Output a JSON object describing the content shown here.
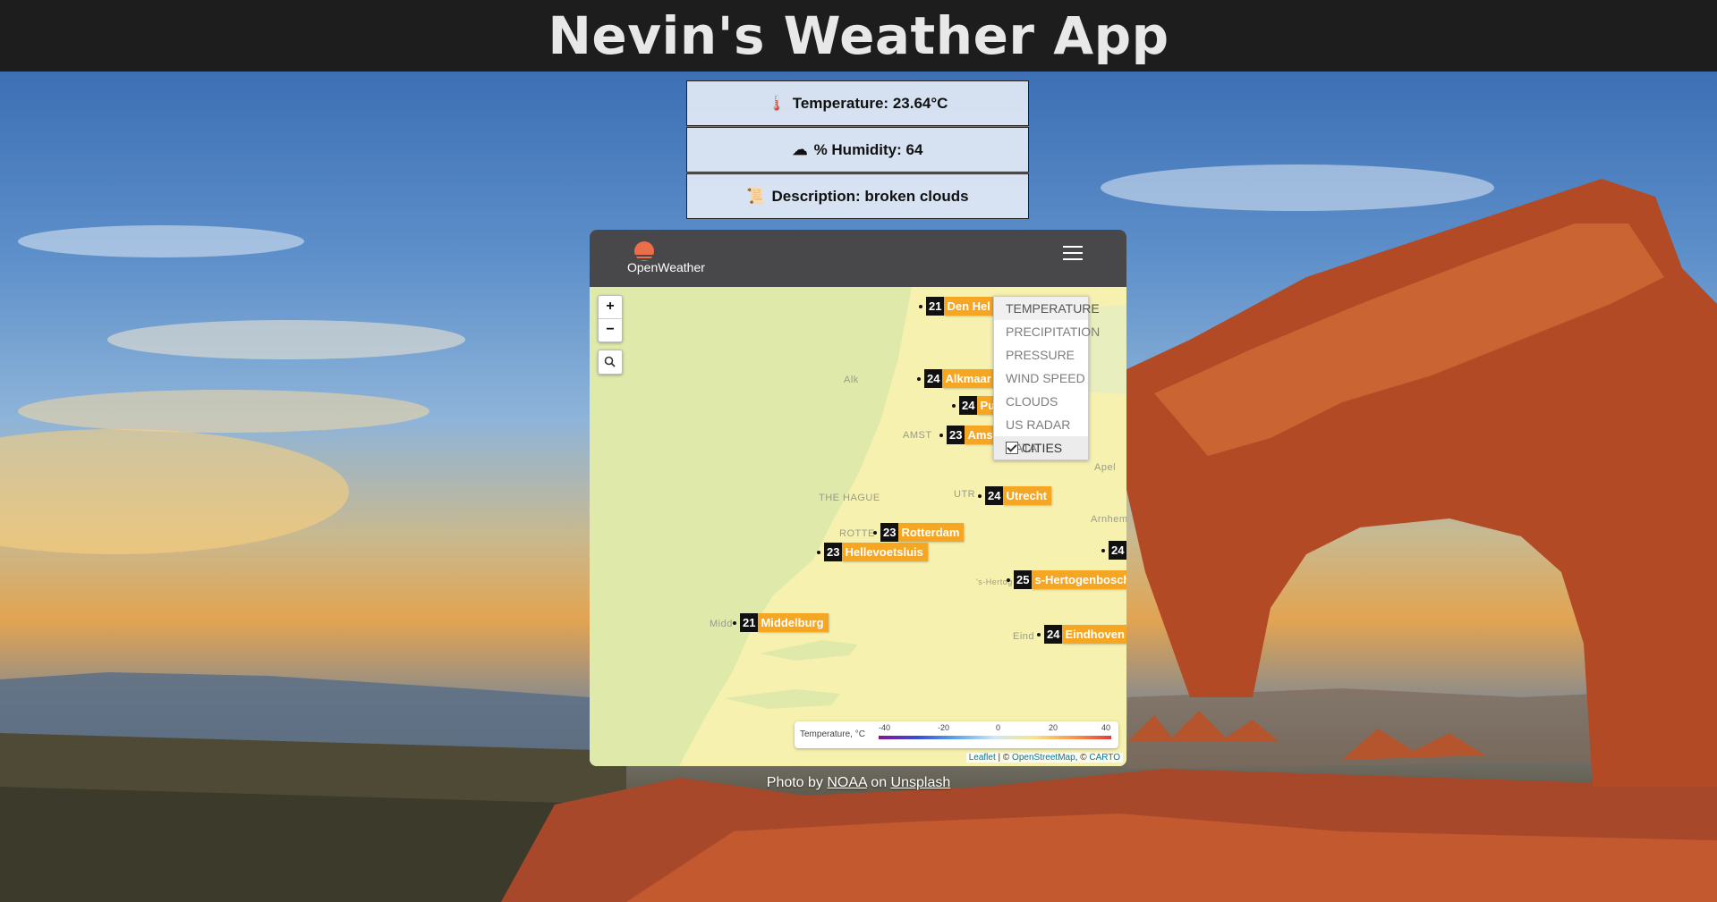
{
  "header": {
    "title": "Nevin's Weather App"
  },
  "weather": {
    "temperature": "Temperature: 23.64°C",
    "humidity": "% Humidity: 64",
    "description": "Description: broken clouds"
  },
  "icons": {
    "temperature": "thermometer-icon",
    "humidity": "cloud-icon",
    "description": "scroll-icon"
  },
  "widget": {
    "brand": "OpenWeather",
    "zoom_in": "+",
    "zoom_out": "−",
    "layers": [
      "TEMPERATURE",
      "PRECIPITATION",
      "PRESSURE",
      "WIND SPEED",
      "CLOUDS",
      "US RADAR DATA",
      "CITIES"
    ],
    "cities": [
      {
        "temp": "21",
        "name": "Den Hel"
      },
      {
        "temp": "24",
        "name": "Alkmaar"
      },
      {
        "temp": "24",
        "name": "Pu"
      },
      {
        "temp": "23",
        "name": "Amsterdam"
      },
      {
        "temp": "24",
        "name": "Utrecht"
      },
      {
        "temp": "23",
        "name": "Rotterdam"
      },
      {
        "temp": "23",
        "name": "Hellevoetsluis"
      },
      {
        "temp": "25",
        "name": "s-Hertogenbosch"
      },
      {
        "temp": "21",
        "name": "Middelburg"
      },
      {
        "temp": "24",
        "name": "Eindhoven"
      },
      {
        "temp": "24",
        "name": ""
      }
    ],
    "places": [
      "Alk",
      "AMST",
      "THE HAGUE",
      "UTR",
      "ROTTE",
      "Apel",
      "Arnhem",
      "'s-Hertog",
      "Midd",
      "Eind"
    ],
    "legend": {
      "title": "Temperature, °C",
      "ticks": [
        "-40",
        "-20",
        "0",
        "20",
        "40"
      ]
    },
    "attribution": {
      "leaflet": "Leaflet",
      "sep1": " | © ",
      "osm": "OpenStreetMap",
      "sep2": ", © ",
      "carto": "CARTO"
    }
  },
  "credit": {
    "prefix": "Photo by ",
    "author": "NOAA",
    "middle": " on ",
    "site": "Unsplash"
  },
  "colors": {
    "header_bg": "#1d1d1d",
    "city_label": "#f5a623",
    "map_land": "#f7f1b0",
    "map_sea": "#dfeaaa"
  }
}
